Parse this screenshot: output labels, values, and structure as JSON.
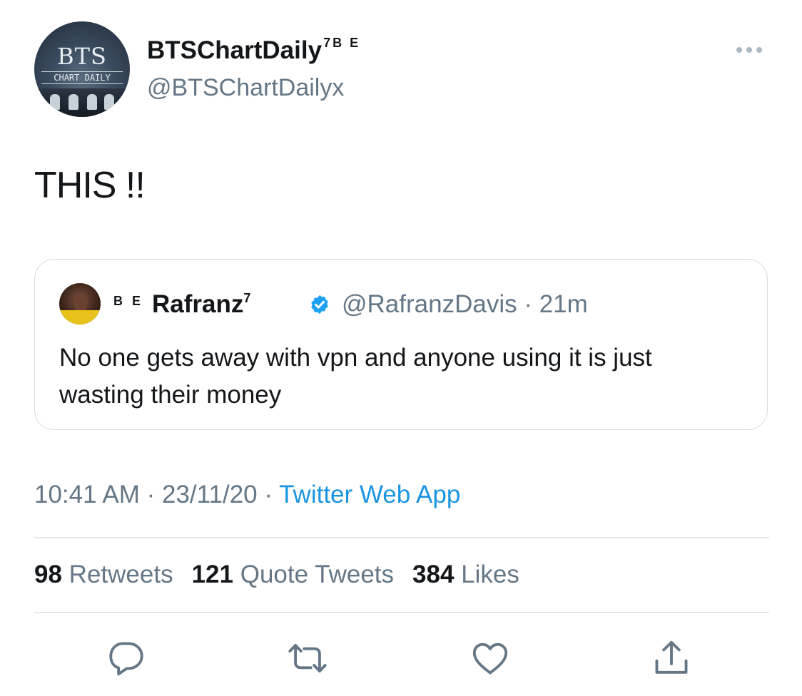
{
  "author": {
    "display_name": "BTSChartDaily",
    "name_badge": "7B E",
    "handle": "@BTSChartDailyx",
    "avatar_text_top": "BTS",
    "avatar_text_bottom": "CHART DAILY"
  },
  "tweet": {
    "text": "THIS !!"
  },
  "quoted_tweet": {
    "prefix_badge": "B E",
    "display_name": "Rafranz",
    "name_superscript": "7",
    "verified": true,
    "handle_time": "@RafranzDavis · 21m",
    "text": "No one gets away with vpn and anyone using it is just wasting their money"
  },
  "meta": {
    "timestamp": "10:41 AM · 23/11/20 · ",
    "source": "Twitter Web App"
  },
  "stats": {
    "retweets_count": "98",
    "retweets_label": "Retweets",
    "quotes_count": "121",
    "quotes_label": "Quote Tweets",
    "likes_count": "384",
    "likes_label": "Likes"
  },
  "icons": {
    "more": "more-horizontal-icon",
    "reply": "reply-icon",
    "retweet": "retweet-icon",
    "like": "heart-icon",
    "share": "share-icon",
    "verified": "verified-badge-icon"
  },
  "colors": {
    "text_primary": "#14171a",
    "text_secondary": "#657786",
    "link": "#1b95e0",
    "verified": "#1da1f2",
    "border": "#e1e8ed"
  }
}
